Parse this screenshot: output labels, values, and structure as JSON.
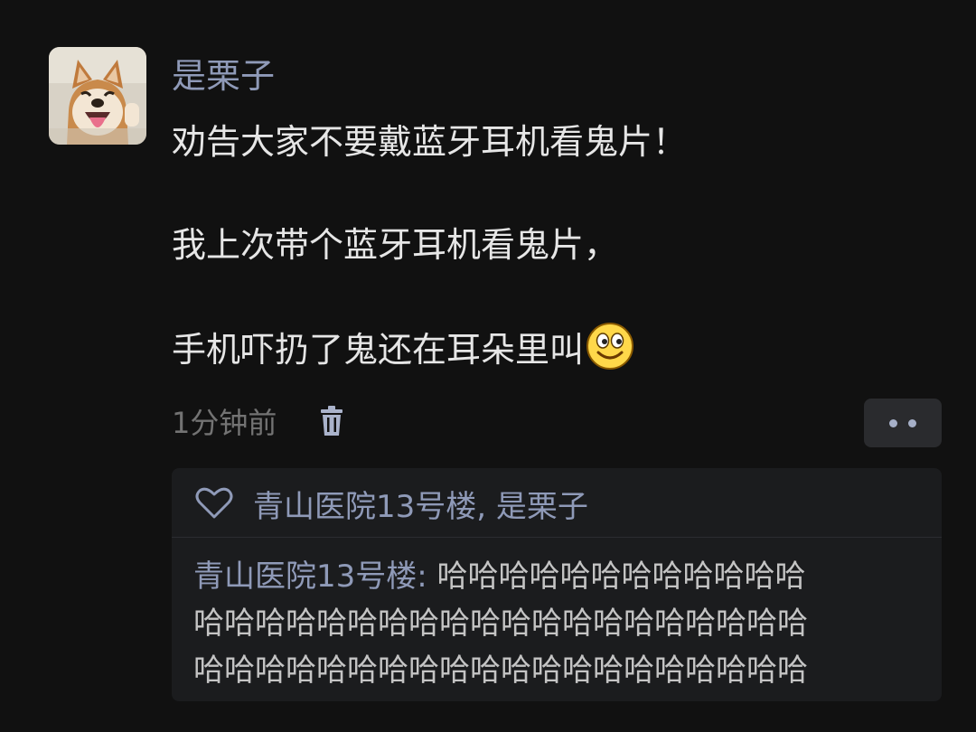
{
  "post": {
    "username": "是栗子",
    "lines": [
      "劝告大家不要戴蓝牙耳机看鬼片！",
      "我上次带个蓝牙耳机看鬼片，",
      "手机吓扔了鬼还在耳朵里叫"
    ],
    "emoji": "smile-emoji",
    "time": "1分钟前"
  },
  "actions": {
    "delete_icon": "trash-icon",
    "more_icon": "more-dots-icon"
  },
  "likes": {
    "icon": "heart-outline-icon",
    "users": "青山医院13号楼, 是栗子"
  },
  "comments": [
    {
      "author": "青山医院13号楼:",
      "text": "哈哈哈哈哈哈哈哈哈哈哈哈\n哈哈哈哈哈哈哈哈哈哈哈哈哈哈哈哈哈哈哈哈\n哈哈哈哈哈哈哈哈哈哈哈哈哈哈哈哈哈哈哈哈"
    }
  ],
  "colors": {
    "background": "#111111",
    "link": "#8f9ab8",
    "text": "#e6e6e6",
    "muted": "#737373",
    "panel": "#1b1c1e"
  }
}
